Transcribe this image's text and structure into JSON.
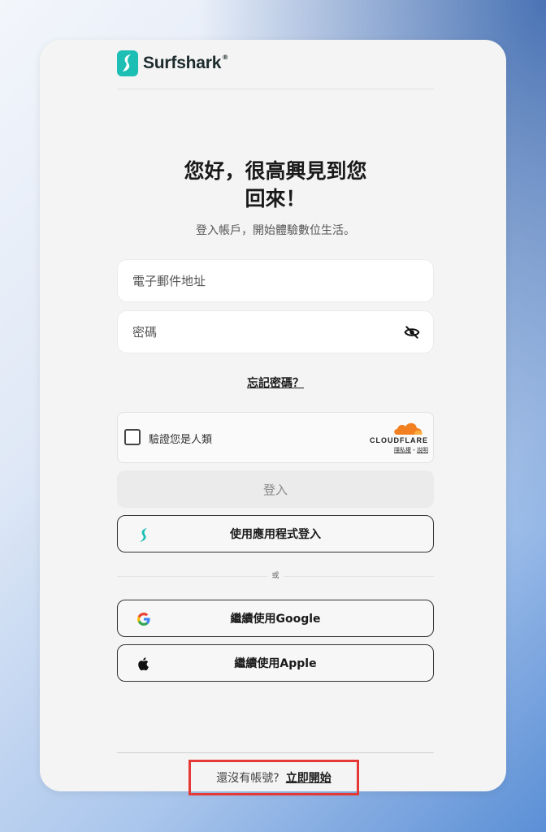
{
  "brand": {
    "name": "Surfshark",
    "registered": "®",
    "color": "#1dbfb4"
  },
  "heading": {
    "line1": "您好，很高興見到您",
    "line2": "回來！"
  },
  "subtitle": "登入帳戶，開始體驗數位生活。",
  "form": {
    "email_placeholder": "電子郵件地址",
    "password_placeholder": "密碼",
    "forgot_label": "忘記密碼？"
  },
  "captcha": {
    "label": "驗證您是人類",
    "provider": "CLOUDFLARE",
    "privacy_link": "隱私權",
    "separator": "・",
    "help_link": "說明",
    "accent": "#f38020"
  },
  "buttons": {
    "login": "登入",
    "app_login": "使用應用程式登入",
    "or": "或",
    "google": "繼續使用Google",
    "apple": "繼續使用Apple"
  },
  "footer": {
    "prompt": "還沒有帳號?",
    "signup": "立即開始",
    "highlight_color": "#e53935"
  }
}
